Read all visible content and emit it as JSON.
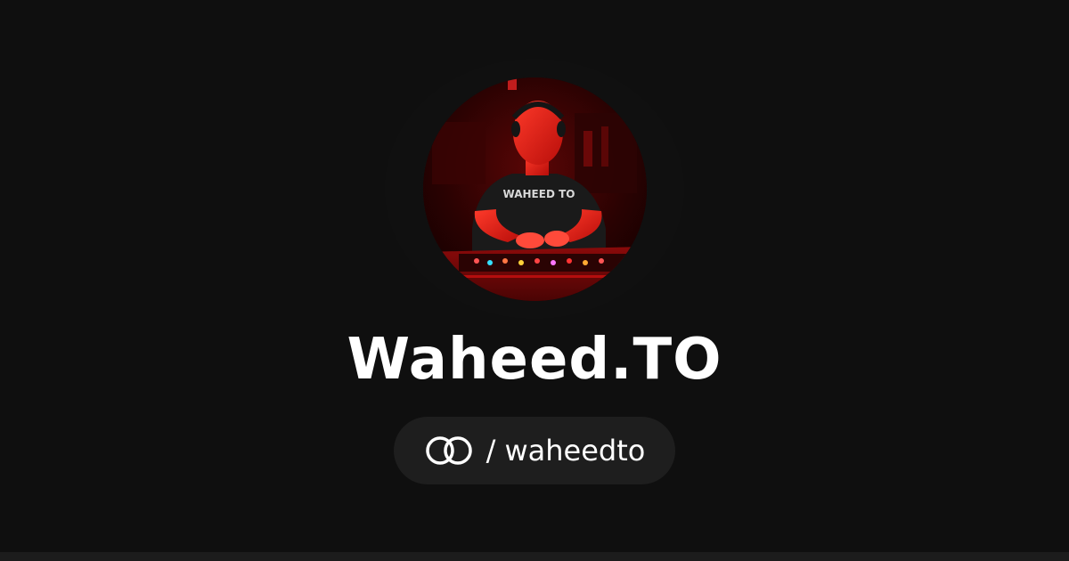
{
  "profile": {
    "display_name": "Waheed.TO",
    "avatar_alt": "Waheed.TO",
    "shirt_text": "WAHEED TO",
    "link_icon": "linked-rings-icon",
    "separator": "/",
    "handle": "waheedto"
  },
  "colors": {
    "background": "#0f0f0f",
    "pill": "#1e1e1e",
    "text": "#ffffff",
    "avatar_accent": "#ff1a1a"
  }
}
